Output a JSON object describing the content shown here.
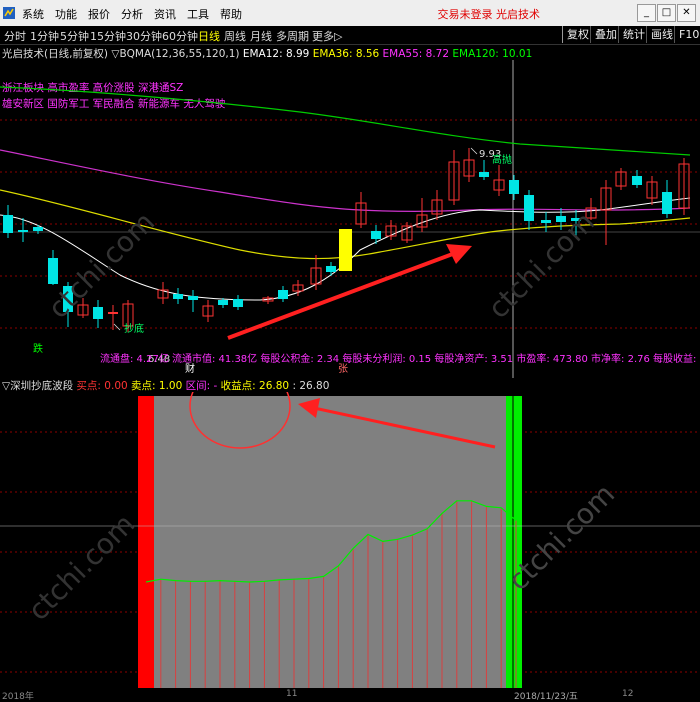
{
  "menu": {
    "items": [
      "系统",
      "功能",
      "报价",
      "分析",
      "资讯",
      "工具",
      "帮助"
    ],
    "status": "交易未登录",
    "brand": "光启技术",
    "window_buttons": [
      "_",
      "□",
      "✕"
    ]
  },
  "periods": {
    "items": [
      "分时",
      "1分钟",
      "5分钟",
      "15分钟",
      "30分钟",
      "60分钟",
      "日线",
      "周线",
      "月线",
      "多周期",
      "更多"
    ],
    "active_index": 6,
    "more_suffix": "▷"
  },
  "toolbar": {
    "items": [
      "复权",
      "叠加",
      "统计",
      "画线",
      "F10"
    ]
  },
  "chart_info": {
    "stock": "光启技术(日线,前复权)",
    "indicator": "▽BQMA(12,36,55,120,1)",
    "ema12": "EMA12: 8.99",
    "ema36": "EMA36: 8.56",
    "ema55": "EMA55: 8.72",
    "ema120": "EMA120: 10.01",
    "colors": {
      "ema12": "#ffffff",
      "ema36": "#ffff00",
      "ema55": "#ff33ff",
      "ema120": "#00ff00"
    }
  },
  "tags": {
    "line1": "浙江板块 高市盈率 高价涨股 深港通SZ",
    "line2": "雄安新区 国防军工 军民融合 新能源车 无人驾驶"
  },
  "price_labels": {
    "high": "9.93",
    "high_note": "高抛",
    "low_note": "抄底",
    "low_value": "6.48"
  },
  "markers": {
    "m1": "跌",
    "m2": "财",
    "m3": "张"
  },
  "finance": {
    "text": "流通盘: 4.27亿 流通市值: 41.38亿 每股公积金: 2.34 每股未分利润: 0.15 每股净资产: 3.51 市盈率: 473.80 市净率: 2.76 每股收益: 0.02"
  },
  "lower_panel": {
    "title": "▽深圳抄底波段",
    "buy": "买点: 0.00",
    "sell": "卖点: 1.00",
    "range": "区间: -",
    "profit": "收益点: 26.80",
    "profit_value": ": 26.80"
  },
  "axis": {
    "left": "2018年",
    "mid": "11",
    "date": "2018/11/23/五",
    "right": "12"
  },
  "watermark": "ctchi.com",
  "chart_data": {
    "type": "candlestick",
    "series": [
      {
        "name": "EMA12",
        "color": "#ffffff"
      },
      {
        "name": "EMA36",
        "color": "#ffff00"
      },
      {
        "name": "EMA55",
        "color": "#ff33ff"
      },
      {
        "name": "EMA120",
        "color": "#00ff00"
      }
    ],
    "lower_series": [
      7.2,
      7.6,
      7.4,
      7.3,
      7.3,
      7.4,
      7.3,
      7.2,
      7.3,
      7.5,
      7.6,
      7.7,
      8.0,
      9.5,
      12.0,
      14.0,
      13.0,
      13.3,
      13.9,
      14.8,
      17.0,
      18.8,
      18.8,
      18.0,
      17.8,
      16.0
    ]
  }
}
